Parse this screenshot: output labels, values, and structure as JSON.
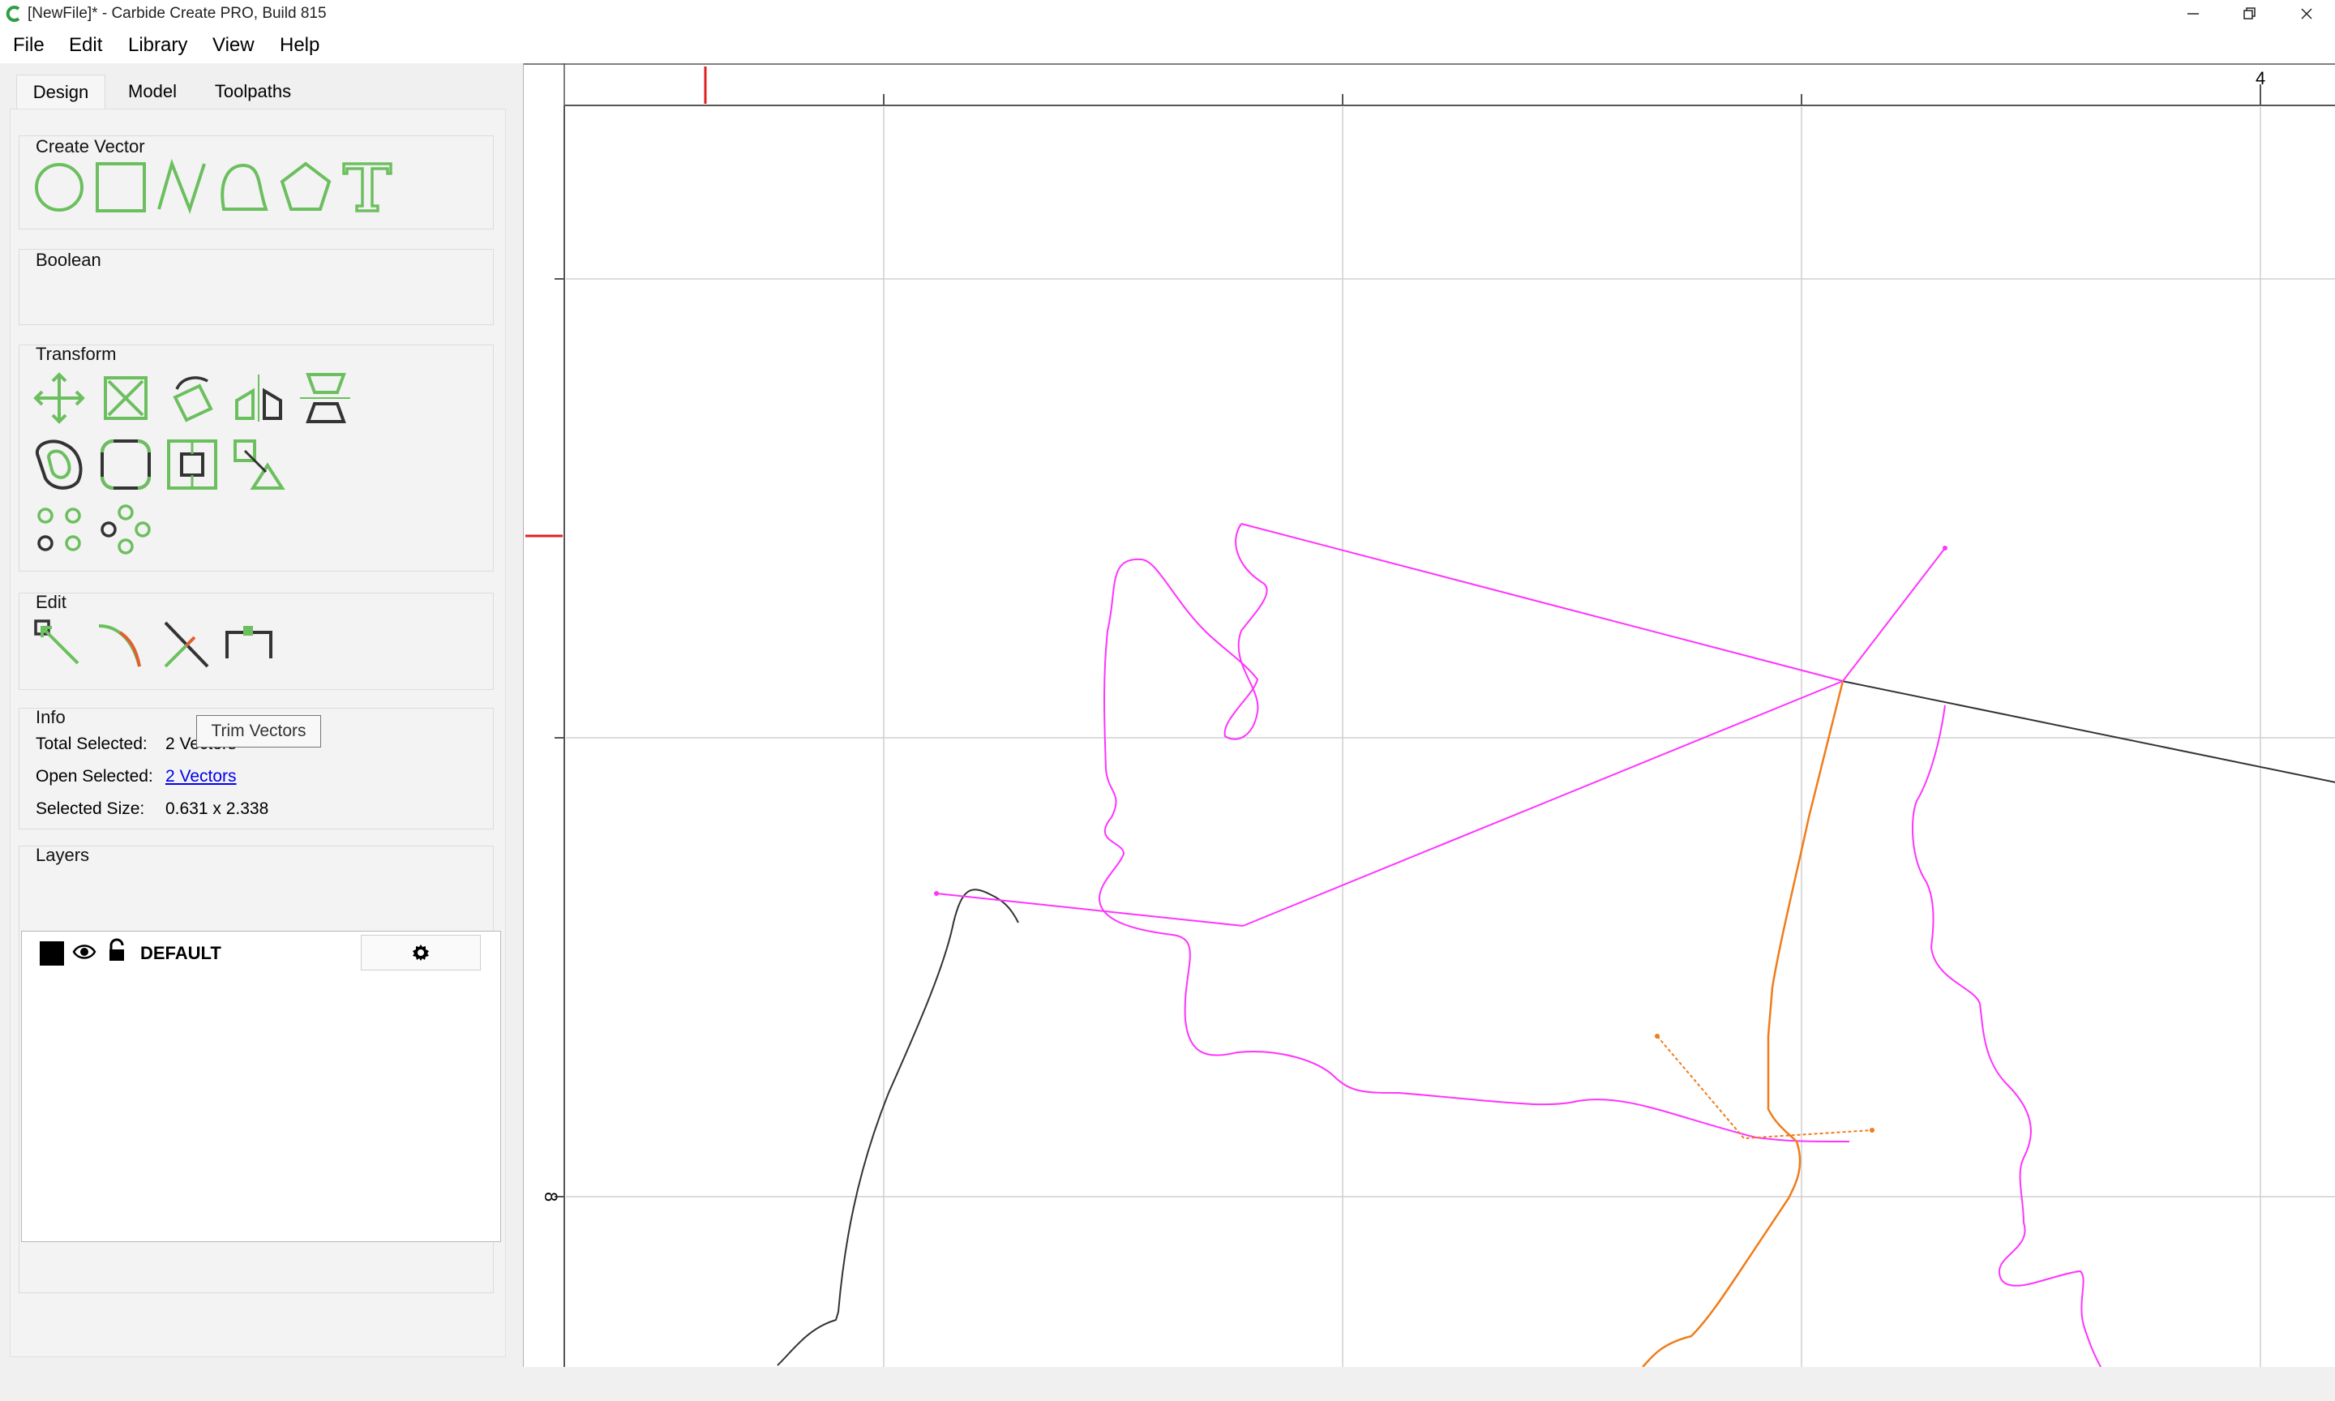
{
  "window": {
    "title": "[NewFile]* - Carbide Create PRO, Build 815",
    "controls": [
      "minimize",
      "maximize",
      "close"
    ]
  },
  "menu": {
    "items": [
      {
        "label": "File"
      },
      {
        "label": "Edit"
      },
      {
        "label": "Library"
      },
      {
        "label": "View"
      },
      {
        "label": "Help"
      }
    ]
  },
  "tabs": [
    {
      "label": "Design",
      "active": true
    },
    {
      "label": "Model",
      "active": false
    },
    {
      "label": "Toolpaths",
      "active": false
    }
  ],
  "panel": {
    "create_vector": {
      "title": "Create Vector",
      "tools": [
        "circle-icon",
        "rectangle-icon",
        "polyline-icon",
        "curve-icon",
        "polygon-icon",
        "text-icon"
      ]
    },
    "boolean": {
      "title": "Boolean"
    },
    "transform": {
      "title": "Transform",
      "tools": [
        "move-icon",
        "scale-icon",
        "rotate-icon",
        "mirror-icon",
        "flip-icon",
        "offset-icon",
        "fillet-icon",
        "align-icon",
        "node-icon",
        "circular-array-icon",
        "rect-array-icon"
      ]
    },
    "edit": {
      "title": "Edit",
      "tools": [
        "node-edit-icon",
        "curve-edit-icon",
        "trim-icon",
        "join-icon"
      ],
      "tooltip": "Trim Vectors"
    },
    "info": {
      "title": "Info",
      "total_selected_label": "Total Selected:",
      "total_selected_value": "2 Vectors",
      "open_selected_label": "Open Selected:",
      "open_selected_value": "2 Vectors",
      "selected_size_label": "Selected Size:",
      "selected_size_value": "0.631 x 2.338"
    },
    "layers": {
      "title": "Layers",
      "items": [
        {
          "name": "DEFAULT",
          "color": "#000000",
          "visible": true,
          "locked": false
        }
      ]
    }
  },
  "canvas": {
    "ruler_top_label": "4",
    "ruler_left_label": "8"
  },
  "colors": {
    "accent_green": "#6cbf5f",
    "magenta": "#ff33ff",
    "orange": "#f07c1a",
    "ruler_marker": "#e02020"
  }
}
